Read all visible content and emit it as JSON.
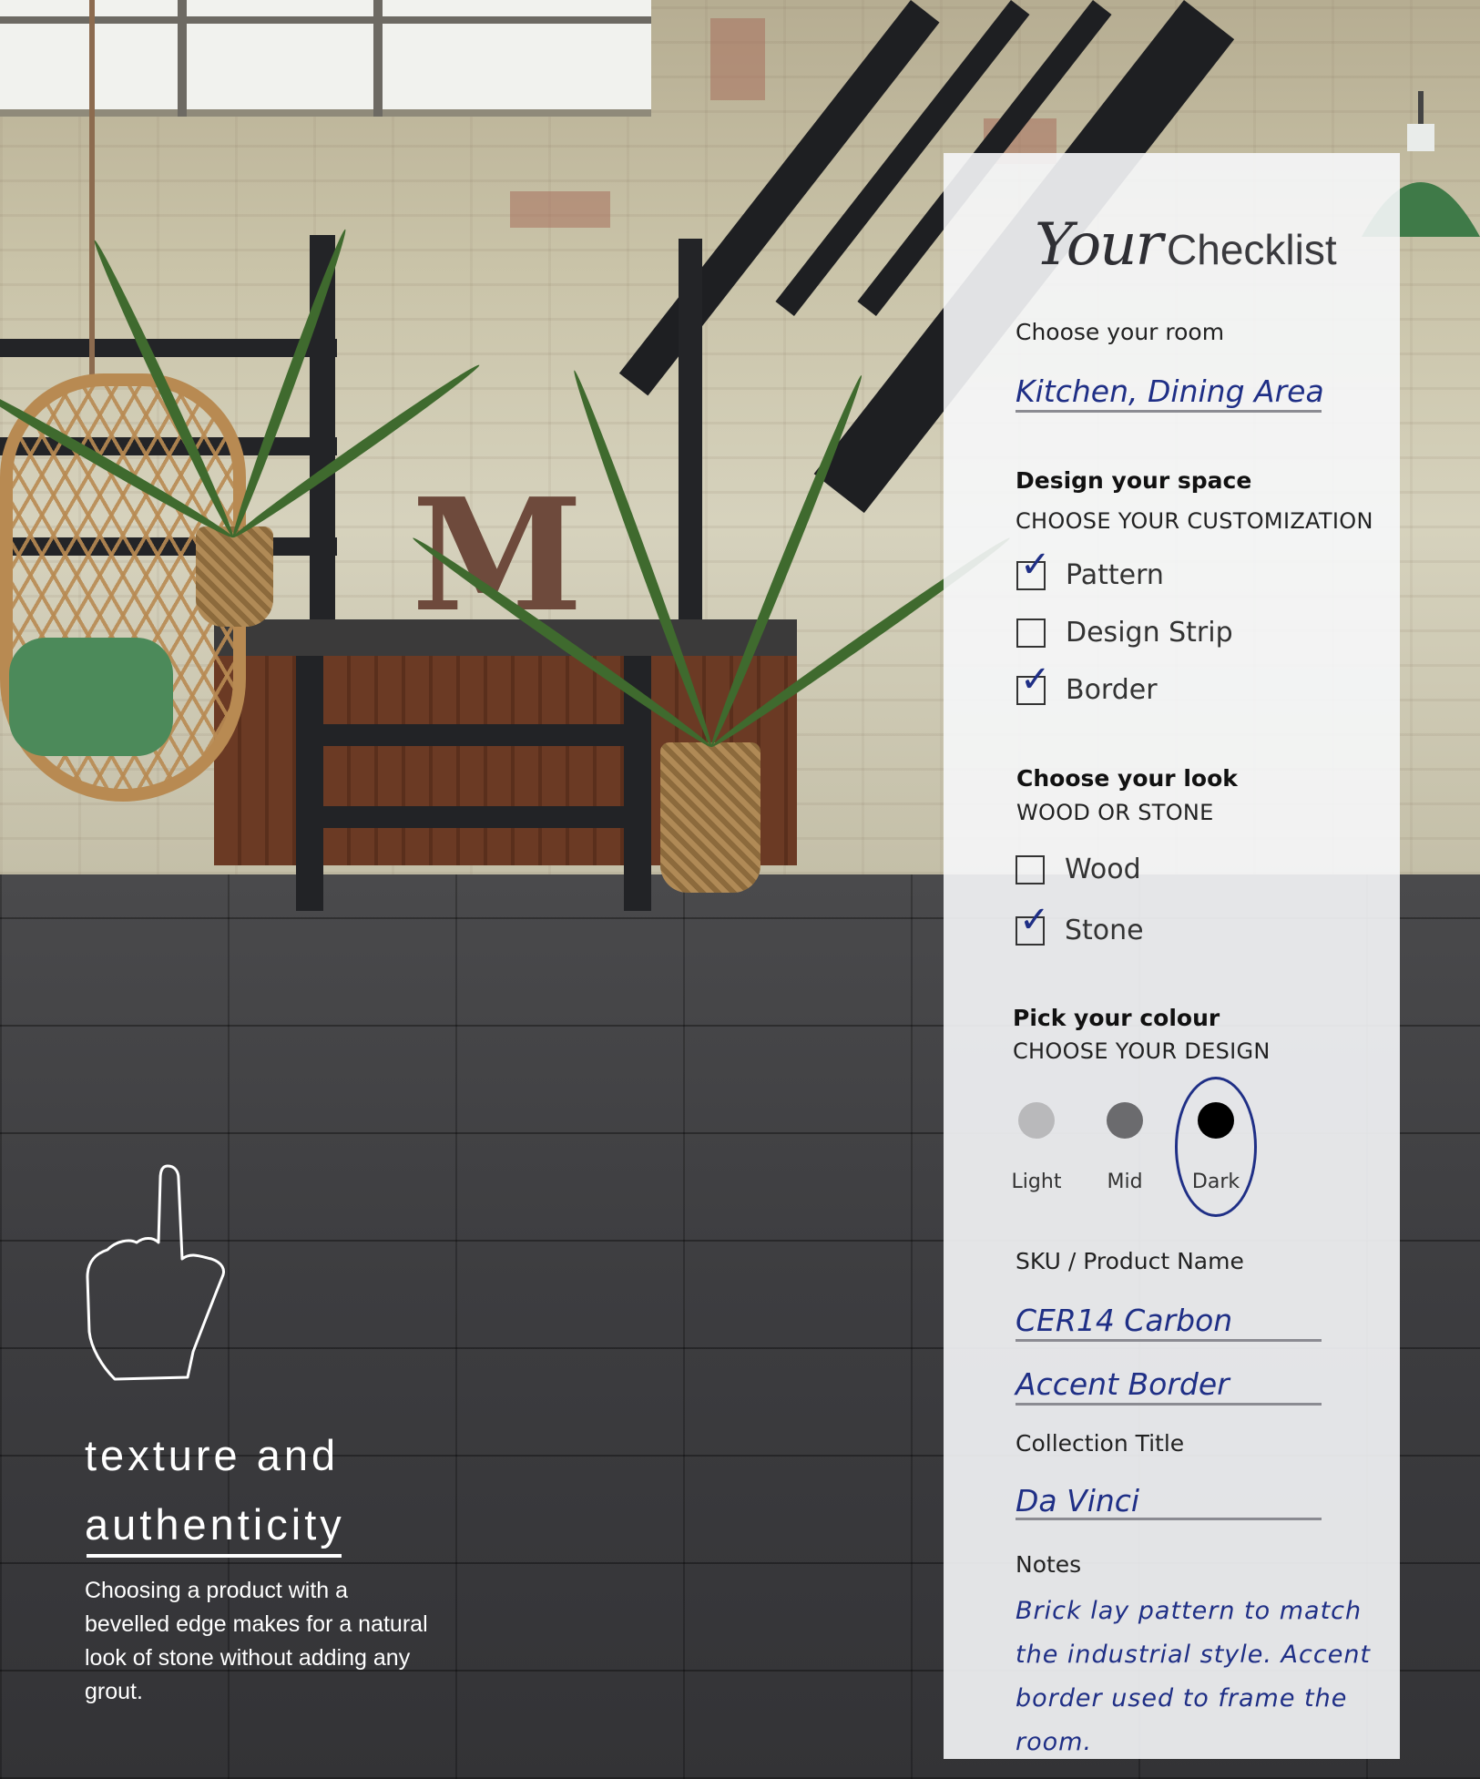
{
  "checklist": {
    "title_script": "Your",
    "title_word": "Checklist",
    "room": {
      "label": "Choose your room",
      "value": "Kitchen, Dining Area"
    },
    "design": {
      "heading": "Design your space",
      "subheading": "CHOOSE YOUR CUSTOMIZATION",
      "options": [
        {
          "label": "Pattern",
          "checked": true
        },
        {
          "label": "Design Strip",
          "checked": false
        },
        {
          "label": "Border",
          "checked": true
        }
      ]
    },
    "look": {
      "heading": "Choose your look",
      "subheading": "WOOD OR STONE",
      "options": [
        {
          "label": "Wood",
          "checked": false
        },
        {
          "label": "Stone",
          "checked": true
        }
      ]
    },
    "colour": {
      "heading": "Pick your colour",
      "subheading": "CHOOSE YOUR DESIGN",
      "swatches": [
        {
          "label": "Light",
          "color": "#b9b9bb"
        },
        {
          "label": "Mid",
          "color": "#6b6b6e"
        },
        {
          "label": "Dark",
          "color": "#000000"
        }
      ],
      "selected": "Dark"
    },
    "sku": {
      "label": "SKU / Product Name",
      "line1": "CER14 Carbon",
      "line2": "Accent Border"
    },
    "collection": {
      "label": "Collection Title",
      "value": "Da Vinci"
    },
    "notes": {
      "label": "Notes",
      "value": "Brick lay pattern to match the industrial style. Accent border used to frame the room."
    }
  },
  "feature": {
    "title_line1": "texture and",
    "title_line2": "authenticity",
    "body": "Choosing a product with a bevelled edge makes for a natural look of stone without adding any grout."
  },
  "icons": {
    "pointer": "pointing-hand-icon",
    "tick": "check-mark-icon"
  },
  "colors": {
    "ink": "#1f2f86",
    "panel": "#f6f7f9"
  }
}
